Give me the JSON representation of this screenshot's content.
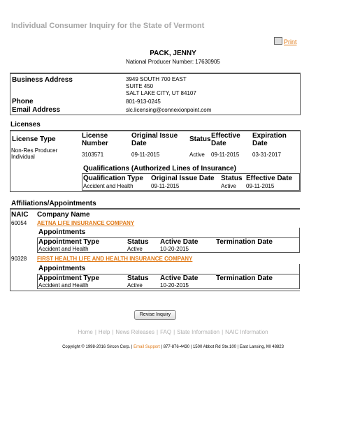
{
  "page_title": "Individual Consumer Inquiry for the State of Vermont",
  "print_label": "Print",
  "producer": {
    "name": "PACK, JENNY",
    "npn_line": "National Producer Number: 17630905"
  },
  "address": {
    "business_label": "Business Address",
    "lines": [
      "3949 SOUTH 700 EAST",
      "SUITE 450",
      "SALT LAKE CITY, UT 84107"
    ],
    "phone_label": "Phone",
    "phone": "801-913-0245",
    "email_label": "Email Address",
    "email": "slc.licensing@connexionpoint.com"
  },
  "licenses": {
    "title": "Licenses",
    "headers": {
      "type": "License Type",
      "number": "License Number",
      "issue": "Original Issue Date",
      "status": "Status",
      "effective": "Effective Date",
      "expiration": "Expiration Date"
    },
    "row": {
      "type": "Non-Res Producer Individual",
      "number": "3103571",
      "issue": "09-11-2015",
      "status": "Active",
      "effective": "09-11-2015",
      "expiration": "03-31-2017"
    },
    "qual_title": "Qualifications (Authorized Lines of Insurance)",
    "qual_headers": {
      "type": "Qualification Type",
      "issue": "Original Issue Date",
      "status": "Status",
      "effective": "Effective Date"
    },
    "qual_row": {
      "type": "Accident and Health",
      "issue": "09-11-2015",
      "status": "Active",
      "effective": "09-11-2015"
    }
  },
  "affiliations": {
    "title": "Affiliations/Appointments",
    "naic_header": "NAIC",
    "company_header": "Company Name",
    "appointments_label": "Appointments",
    "appt_headers": {
      "type": "Appointment Type",
      "status": "Status",
      "active": "Active Date",
      "termination": "Termination Date"
    },
    "companies": [
      {
        "naic": "60054",
        "name": "AETNA LIFE INSURANCE COMPANY",
        "appt": {
          "type": "Accident and Health",
          "status": "Active",
          "active": "10-20-2015",
          "termination": ""
        }
      },
      {
        "naic": "90328",
        "name": "FIRST HEALTH LIFE AND HEALTH INSURANCE COMPANY",
        "appt": {
          "type": "Accident and Health",
          "status": "Active",
          "active": "10-20-2015",
          "termination": ""
        }
      }
    ]
  },
  "revise_button": "Revise Inquiry",
  "footer_links": [
    "Home",
    "Help",
    "News Releases",
    "FAQ",
    "State Information",
    "NAIC Information"
  ],
  "copyright": {
    "pre": "Copyright © 1998-2016 Sircon Corp. | ",
    "email": "Email Support",
    "post": " | 877-876-4430 | 1500 Abbot Rd Ste.100 | East Lansing, MI 48823"
  }
}
